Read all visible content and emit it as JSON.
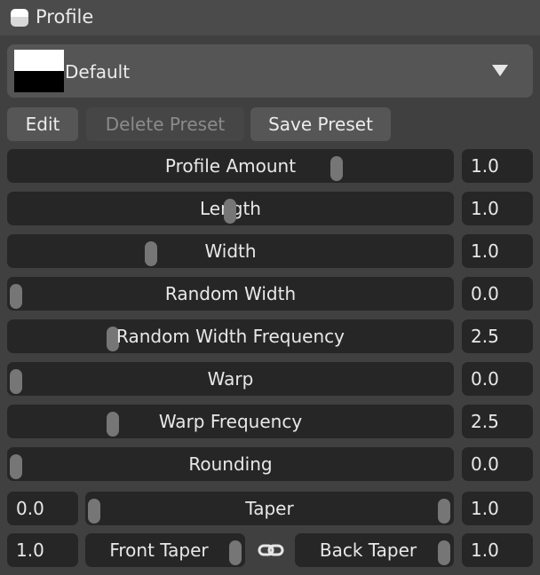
{
  "window": {
    "title": "Profile"
  },
  "preset": {
    "name": "Default"
  },
  "buttons": {
    "edit": "Edit",
    "delete": "Delete Preset",
    "save": "Save Preset"
  },
  "sliders": [
    {
      "label": "Profile Amount",
      "value": "1.0"
    },
    {
      "label": "Length",
      "value": "1.0"
    },
    {
      "label": "Width",
      "value": "1.0"
    },
    {
      "label": "Random Width",
      "value": "0.0"
    },
    {
      "label": "Random Width Frequency",
      "value": "2.5"
    },
    {
      "label": "Warp",
      "value": "0.0"
    },
    {
      "label": "Warp Frequency",
      "value": "2.5"
    },
    {
      "label": "Rounding",
      "value": "0.0"
    }
  ],
  "taper": {
    "label": "Taper",
    "left_value": "0.0",
    "right_value": "1.0"
  },
  "front_taper": {
    "label": "Front Taper",
    "value": "1.0"
  },
  "back_taper": {
    "label": "Back Taper",
    "value": "1.0"
  },
  "icons": {
    "window": "window-icon",
    "dropdown": "chevron-down-icon",
    "link": "chain-link-icon"
  }
}
